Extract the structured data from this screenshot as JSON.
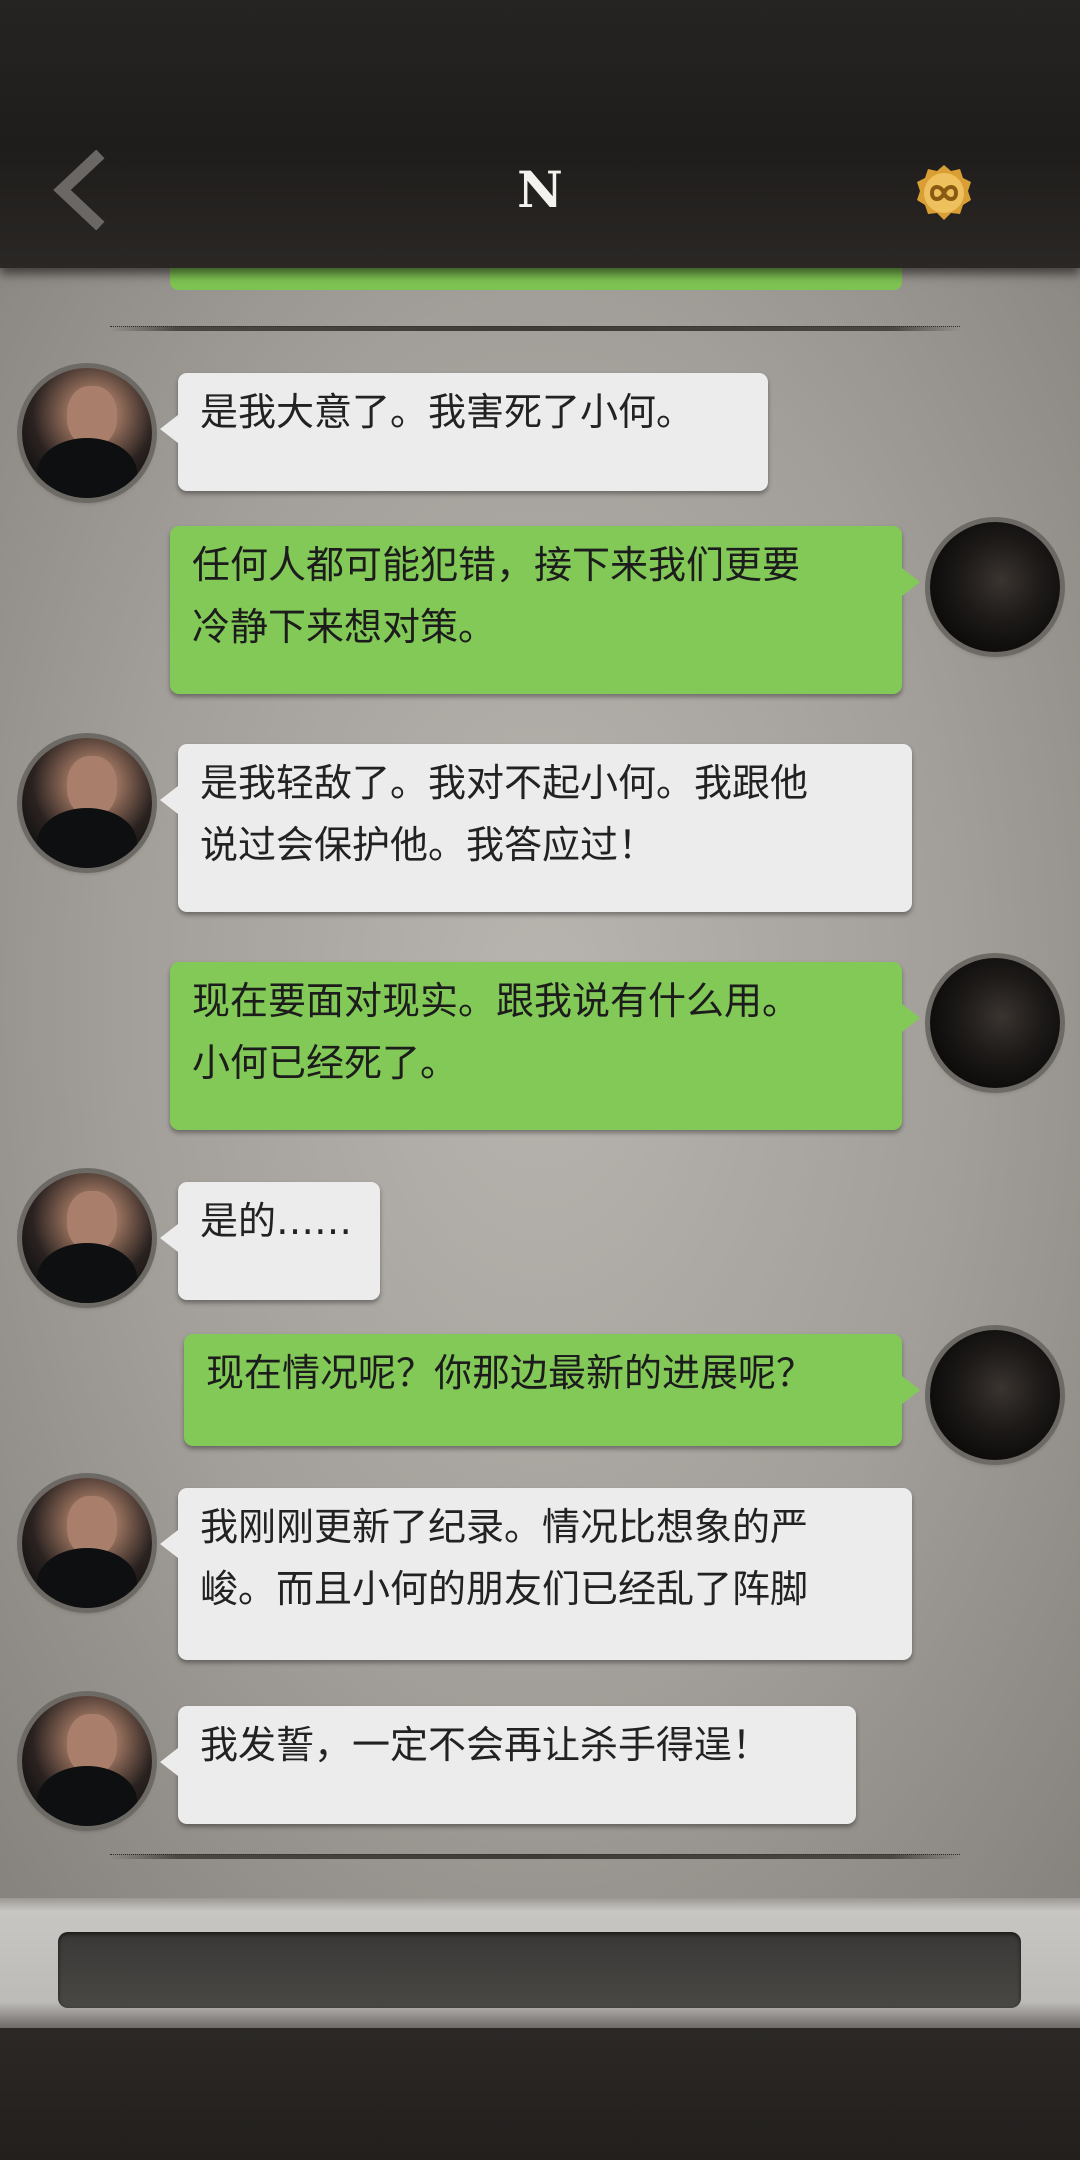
{
  "header": {
    "title": "N",
    "back_icon": "chevron-left-icon",
    "coin_icon": "infinity-coin-icon",
    "colors": {
      "bar": "#221f1d",
      "title": "#f4f2ef",
      "coin": "#e0a93a"
    }
  },
  "messages": [
    {
      "side": "left",
      "lines": [
        "是我大意了。我害死了小何。"
      ]
    },
    {
      "side": "right",
      "lines": [
        "任何人都可能犯错，接下来我们更要",
        "冷静下来想对策。"
      ]
    },
    {
      "side": "left",
      "lines": [
        "是我轻敌了。我对不起小何。我跟他",
        "说过会保护他。我答应过！"
      ]
    },
    {
      "side": "right",
      "lines": [
        "现在要面对现实。跟我说有什么用。",
        "小何已经死了。"
      ]
    },
    {
      "side": "left",
      "lines": [
        "是的……"
      ]
    },
    {
      "side": "right",
      "lines": [
        "现在情况呢？你那边最新的进展呢？"
      ]
    },
    {
      "side": "left",
      "lines": [
        "我刚刚更新了纪录。情况比想象的严",
        "峻。而且小何的朋友们已经乱了阵脚"
      ]
    },
    {
      "side": "left",
      "lines": [
        "我发誓，一定不会再让杀手得逞！"
      ]
    }
  ],
  "colors": {
    "left_bubble": "#ececec",
    "right_bubble": "#82c957",
    "background": "#a29e99"
  }
}
